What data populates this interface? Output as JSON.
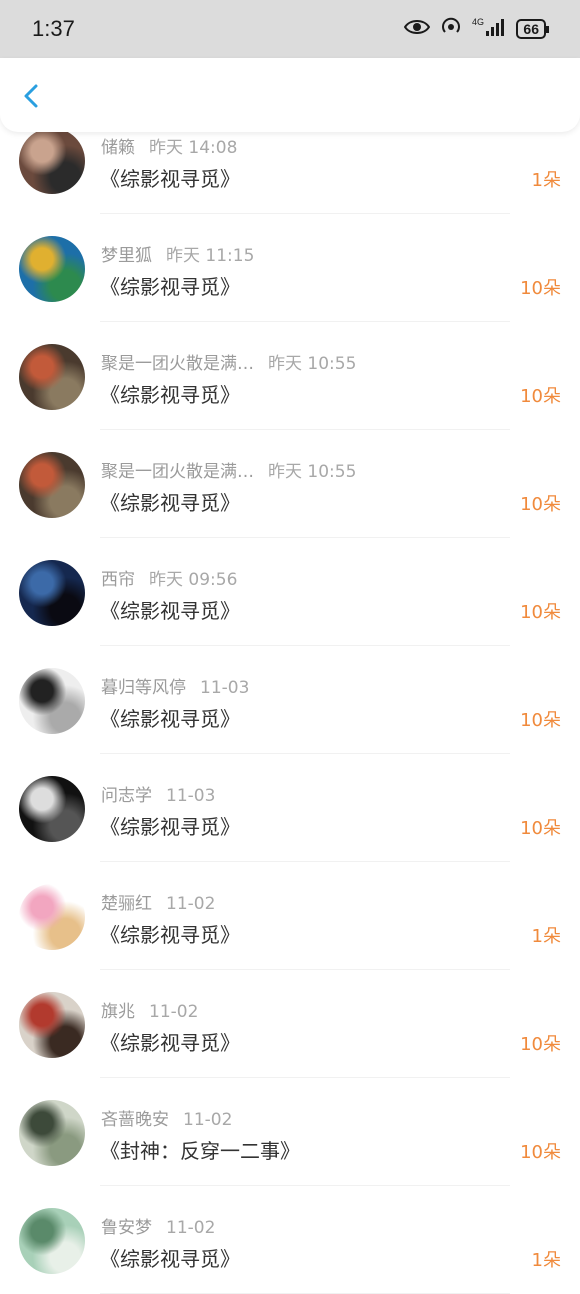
{
  "status_bar": {
    "time": "1:37",
    "network": "4G",
    "battery": "66"
  },
  "header": {
    "back_label": "<"
  },
  "items": [
    {
      "name": "储籁",
      "time": "昨天 14:08",
      "title": "《综影视寻觅》",
      "count": "1朵",
      "avatar_colors": [
        "#6b4a3d",
        "#c9a38e",
        "#2b2b2b"
      ]
    },
    {
      "name": "梦里狐",
      "time": "昨天 11:15",
      "title": "《综影视寻觅》",
      "count": "10朵",
      "avatar_colors": [
        "#1d6fa8",
        "#e0b030",
        "#2d8a4e"
      ]
    },
    {
      "name": "聚是一团火散是满…",
      "time": "昨天 10:55",
      "title": "《综影视寻觅》",
      "count": "10朵",
      "avatar_colors": [
        "#4a3a2e",
        "#c25a3a",
        "#8a7a60"
      ]
    },
    {
      "name": "聚是一团火散是满…",
      "time": "昨天 10:55",
      "title": "《综影视寻觅》",
      "count": "10朵",
      "avatar_colors": [
        "#4a3a2e",
        "#c25a3a",
        "#8a7a60"
      ]
    },
    {
      "name": "西帘",
      "time": "昨天 09:56",
      "title": "《综影视寻觅》",
      "count": "10朵",
      "avatar_colors": [
        "#15284f",
        "#3c6aa8",
        "#0a0a12"
      ]
    },
    {
      "name": "暮归等风停",
      "time": "11-03",
      "title": "《综影视寻觅》",
      "count": "10朵",
      "avatar_colors": [
        "#eeeeee",
        "#222222",
        "#aaaaaa"
      ]
    },
    {
      "name": "问志学",
      "time": "11-03",
      "title": "《综影视寻觅》",
      "count": "10朵",
      "avatar_colors": [
        "#111111",
        "#dddddd",
        "#555555"
      ]
    },
    {
      "name": "楚骊红",
      "time": "11-02",
      "title": "《综影视寻觅》",
      "count": "1朵",
      "avatar_colors": [
        "#ffffff",
        "#f2a6c0",
        "#e7c08a"
      ]
    },
    {
      "name": "旗兆",
      "time": "11-02",
      "title": "《综影视寻觅》",
      "count": "10朵",
      "avatar_colors": [
        "#d9d2c9",
        "#b23a2e",
        "#3a2a22"
      ]
    },
    {
      "name": "吝蔷晚安",
      "time": "11-02",
      "title": "《封神：反穿一二事》",
      "count": "10朵",
      "avatar_colors": [
        "#cfd6c8",
        "#3d4a3a",
        "#8a9a80"
      ]
    },
    {
      "name": "鲁安梦",
      "time": "11-02",
      "title": "《综影视寻觅》",
      "count": "1朵",
      "avatar_colors": [
        "#a8d0b8",
        "#5a8a6a",
        "#e8f0e8"
      ]
    }
  ]
}
